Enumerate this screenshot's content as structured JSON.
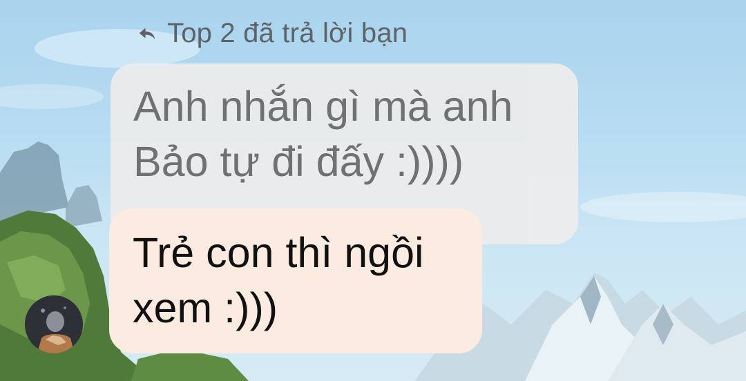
{
  "reply_context": {
    "icon": "reply-arrow-icon",
    "label": "Top 2 đã trả lời bạn"
  },
  "quoted_message": {
    "lines": [
      "Anh nhắn gì mà anh",
      "Bảo tự đi đấy :))))"
    ]
  },
  "reply_message": {
    "lines": [
      "Trẻ con thì ngồi",
      "xem :)))"
    ]
  },
  "sender": {
    "avatar_icon": "avatar-photo"
  },
  "colors": {
    "quoted_bubble": "#ececec",
    "reply_bubble": "#fcebe0",
    "secondary_text": "#5f6368",
    "primary_text": "#111111"
  }
}
